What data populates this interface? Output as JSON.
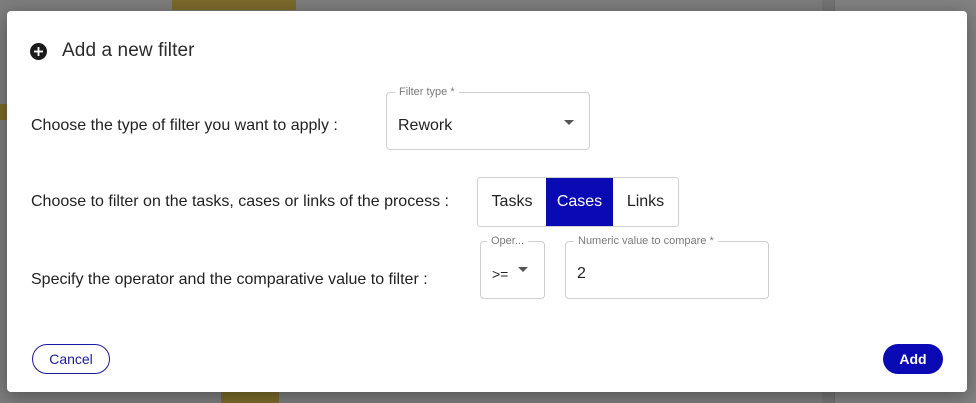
{
  "dialog": {
    "title": "Add a new filter",
    "icon": "plus-circle-icon"
  },
  "filter_type": {
    "label": "Choose the type of filter you want to apply :",
    "legend": "Filter type *",
    "value": "Rework"
  },
  "target": {
    "label": "Choose to filter on the tasks, cases or links of the process :",
    "options": [
      "Tasks",
      "Cases",
      "Links"
    ],
    "selected": "Cases"
  },
  "comparison": {
    "label": "Specify the operator and the comparative value to filter :",
    "operator_legend": "Oper...",
    "operator_value": ">=",
    "value_legend": "Numeric value to compare *",
    "value": "2"
  },
  "buttons": {
    "cancel": "Cancel",
    "add": "Add"
  },
  "colors": {
    "accent": "#0a0ab5",
    "overlay": "#7d7d7d"
  }
}
